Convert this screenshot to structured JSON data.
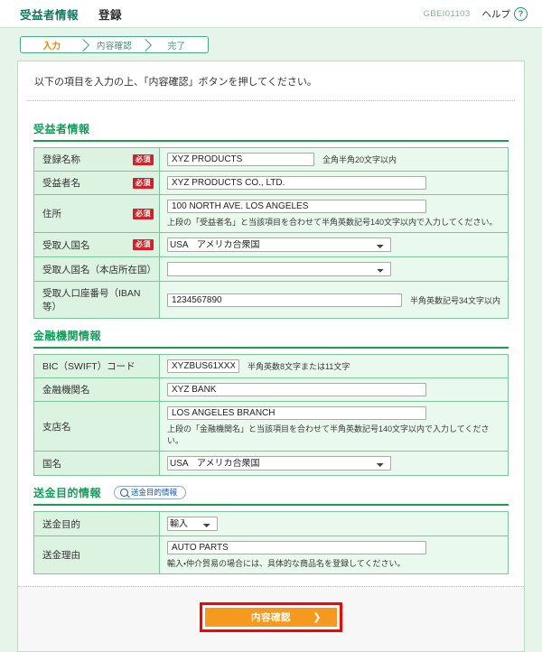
{
  "header": {
    "title_main": "受益者情報",
    "title_sub": "登録",
    "screen_id": "GBEI01103",
    "help_label": "ヘルプ",
    "help_icon": "?"
  },
  "steps": [
    {
      "label": "入力",
      "active": true
    },
    {
      "label": "内容確認",
      "active": false
    },
    {
      "label": "完了",
      "active": false
    }
  ],
  "lead_text": "以下の項目を入力の上、「内容確認」ボタンを押してください。",
  "sections": {
    "beneficiary": {
      "title": "受益者情報",
      "rows": {
        "reg_name": {
          "label": "登録名称",
          "required": "必須",
          "value": "XYZ PRODUCTS",
          "hint": "全角半角20文字以内"
        },
        "bene_name": {
          "label": "受益者名",
          "required": "必須",
          "value": "XYZ PRODUCTS CO., LTD."
        },
        "address": {
          "label": "住所",
          "required": "必須",
          "value": "100 NORTH AVE. LOS ANGELES",
          "note": "上段の「受益者名」と当該項目を合わせて半角英数記号140文字以内で入力してください。"
        },
        "payee_country": {
          "label": "受取人国名",
          "required": "必須",
          "value": "USA　アメリカ合衆国"
        },
        "payee_country_head": {
          "label": "受取人国名（本店所在国）",
          "value": ""
        },
        "account_no": {
          "label": "受取人口座番号（IBAN等）",
          "value": "1234567890",
          "hint": "半角英数記号34文字以内"
        }
      }
    },
    "bank": {
      "title": "金融機関情報",
      "rows": {
        "bic": {
          "label": "BIC（SWIFT）コード",
          "value": "XYZBUS61XXX",
          "hint": "半角英数8文字または11文字"
        },
        "bank_name": {
          "label": "金融機関名",
          "value": "XYZ BANK"
        },
        "branch": {
          "label": "支店名",
          "value": "LOS ANGELES BRANCH",
          "note": "上段の「金融機関名」と当該項目を合わせて半角英数記号140文字以内で入力してください。"
        },
        "country": {
          "label": "国名",
          "value": "USA　アメリカ合衆国"
        }
      }
    },
    "purpose": {
      "title": "送金目的情報",
      "lookup_button": "送金目的情報",
      "lookup_icon": "search-icon",
      "rows": {
        "purpose": {
          "label": "送金目的",
          "value": "輸入"
        },
        "reason": {
          "label": "送金理由",
          "value": "AUTO PARTS",
          "note": "輸入・仲介貿易の場合には、具体的な商品名を登録してください。"
        }
      }
    }
  },
  "footer": {
    "submit_label": "内容確認",
    "submit_chevron": "❯"
  }
}
